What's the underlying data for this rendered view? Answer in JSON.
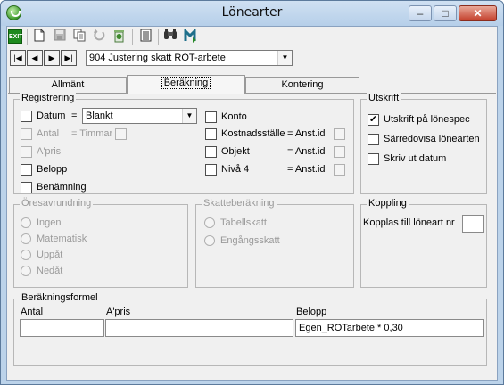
{
  "window": {
    "title": "Lönearter"
  },
  "toolbar": {
    "exit_label": "EXIT",
    "icons": [
      "exit-icon",
      "new-document-icon",
      "save-icon",
      "copy-icon",
      "undo-icon",
      "delete-icon",
      "list-icon",
      "binoculars-icon",
      "merge-icon"
    ]
  },
  "record": {
    "selected": "904 Justering skatt ROT-arbete"
  },
  "tabs": [
    {
      "label": "Allmänt"
    },
    {
      "label": "Beräkning"
    },
    {
      "label": "Kontering"
    }
  ],
  "registrering": {
    "legend": "Registrering",
    "datum_label": "Datum",
    "datum_eq": "=",
    "datum_value": "Blankt",
    "antal_label": "Antal",
    "antal_eq": "= Timmar",
    "apris_label": "A'pris",
    "belopp_label": "Belopp",
    "benamning_label": "Benämning",
    "konto_label": "Konto",
    "kostnadsstalle_label": "Kostnadsställe",
    "kostnadsstalle_eq": "= Anst.id",
    "objekt_label": "Objekt",
    "objekt_eq": "= Anst.id",
    "niva4_label": "Nivå 4",
    "niva4_eq": "= Anst.id"
  },
  "utskrift": {
    "legend": "Utskrift",
    "items": [
      {
        "label": "Utskrift på lönespec",
        "checked": true
      },
      {
        "label": "Särredovisa lönearten",
        "checked": false
      },
      {
        "label": "Skriv ut datum",
        "checked": false
      }
    ]
  },
  "oresavrundning": {
    "legend": "Öresavrundning",
    "options": [
      "Ingen",
      "Matematisk",
      "Uppåt",
      "Nedåt"
    ]
  },
  "skatteberakning": {
    "legend": "Skatteberäkning",
    "options": [
      "Tabellskatt",
      "Engångsskatt"
    ]
  },
  "koppling": {
    "legend": "Koppling",
    "label": "Kopplas till löneart nr",
    "value": ""
  },
  "formel": {
    "legend": "Beräkningsformel",
    "antal_label": "Antal",
    "apris_label": "A'pris",
    "belopp_label": "Belopp",
    "antal_value": "",
    "apris_value": "",
    "belopp_value": "Egen_ROTarbete * 0,30"
  }
}
